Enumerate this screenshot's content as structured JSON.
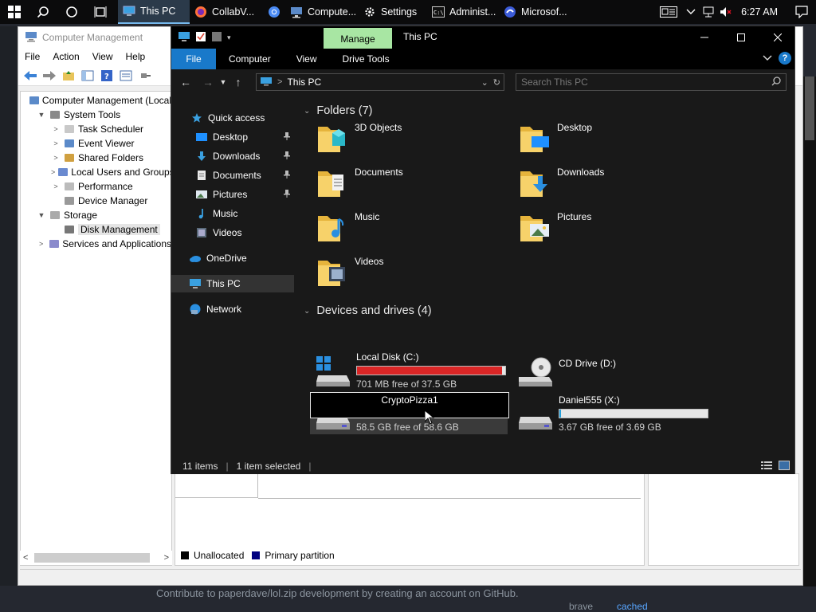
{
  "taskbar": {
    "apps": [
      {
        "label": "This PC",
        "icon": "this-pc-icon"
      },
      {
        "label": "CollabV...",
        "icon": "firefox-icon"
      },
      {
        "label": "",
        "icon": "chrome-icon"
      },
      {
        "label": "Compute...",
        "icon": "computer-management-icon"
      },
      {
        "label": "Settings",
        "icon": "gear-icon"
      },
      {
        "label": "Administ...",
        "icon": "cmd-icon"
      },
      {
        "label": "Microsof...",
        "icon": "edge-icon"
      }
    ],
    "clock": "6:27 AM"
  },
  "computer_management": {
    "title": "Computer Management",
    "menu": [
      "File",
      "Action",
      "View",
      "Help"
    ],
    "tree": [
      {
        "label": "Computer Management (Local",
        "level": 0,
        "twisty": ""
      },
      {
        "label": "System Tools",
        "level": 1,
        "twisty": "▼"
      },
      {
        "label": "Task Scheduler",
        "level": 2,
        "twisty": ">"
      },
      {
        "label": "Event Viewer",
        "level": 2,
        "twisty": ">"
      },
      {
        "label": "Shared Folders",
        "level": 2,
        "twisty": ">"
      },
      {
        "label": "Local Users and Groups",
        "level": 2,
        "twisty": ">"
      },
      {
        "label": "Performance",
        "level": 2,
        "twisty": ">"
      },
      {
        "label": "Device Manager",
        "level": 2,
        "twisty": ""
      },
      {
        "label": "Storage",
        "level": 1,
        "twisty": "▼"
      },
      {
        "label": "Disk Management",
        "level": 2,
        "twisty": "",
        "selected": true
      },
      {
        "label": "Services and Applications",
        "level": 1,
        "twisty": ">"
      }
    ],
    "legend": [
      {
        "label": "Unallocated",
        "color": "#000000"
      },
      {
        "label": "Primary partition",
        "color": "#000080"
      }
    ]
  },
  "explorer": {
    "title": "This PC",
    "manage_tab": "Manage",
    "tabs": [
      "File",
      "Computer",
      "View",
      "Drive Tools"
    ],
    "address": "This PC",
    "search_placeholder": "Search This PC",
    "sidebar": [
      {
        "label": "Quick access",
        "icon": "star-icon",
        "pinned": false
      },
      {
        "label": "Desktop",
        "icon": "desktop-icon",
        "pinned": true
      },
      {
        "label": "Downloads",
        "icon": "download-icon",
        "pinned": true
      },
      {
        "label": "Documents",
        "icon": "document-icon",
        "pinned": true
      },
      {
        "label": "Pictures",
        "icon": "pictures-icon",
        "pinned": true
      },
      {
        "label": "Music",
        "icon": "music-icon",
        "pinned": false
      },
      {
        "label": "Videos",
        "icon": "videos-icon",
        "pinned": false
      },
      {
        "label": "OneDrive",
        "icon": "cloud-icon",
        "pinned": false
      },
      {
        "label": "This PC",
        "icon": "this-pc-icon",
        "pinned": false,
        "selected": true
      },
      {
        "label": "Network",
        "icon": "network-icon",
        "pinned": false
      }
    ],
    "folders_header": "Folders (7)",
    "folders": [
      {
        "label": "3D Objects",
        "icon": "3d-objects-icon"
      },
      {
        "label": "Desktop",
        "icon": "desktop-folder-icon"
      },
      {
        "label": "Documents",
        "icon": "documents-folder-icon"
      },
      {
        "label": "Downloads",
        "icon": "downloads-folder-icon"
      },
      {
        "label": "Music",
        "icon": "music-folder-icon"
      },
      {
        "label": "Pictures",
        "icon": "pictures-folder-icon"
      },
      {
        "label": "Videos",
        "icon": "videos-folder-icon"
      }
    ],
    "drives_header": "Devices and drives (4)",
    "drives": [
      {
        "label": "Local Disk (C:)",
        "free": "701 MB free of 37.5 GB",
        "used_fraction": 0.98,
        "bar_color": "#da2626",
        "icon": "windows-drive-icon"
      },
      {
        "label": "CD Drive (D:)",
        "free": "",
        "icon": "cd-drive-icon"
      },
      {
        "label": "CryptoPizza1",
        "free": "58.5 GB free of 58.6 GB",
        "used_fraction": 0.0,
        "icon": "hard-drive-icon",
        "renaming": true
      },
      {
        "label": "Daniel555 (X:)",
        "free": "3.67 GB free of 3.69 GB",
        "used_fraction": 0.01,
        "bar_color": "#26a0da",
        "icon": "hard-drive-icon"
      }
    ],
    "status": {
      "items": "11 items",
      "selected": "1 item selected"
    }
  },
  "background": {
    "footer_text": "Contribute to paperdave/lol.zip development by creating an account on GitHub.",
    "brave": "brave",
    "cached": "cached"
  }
}
